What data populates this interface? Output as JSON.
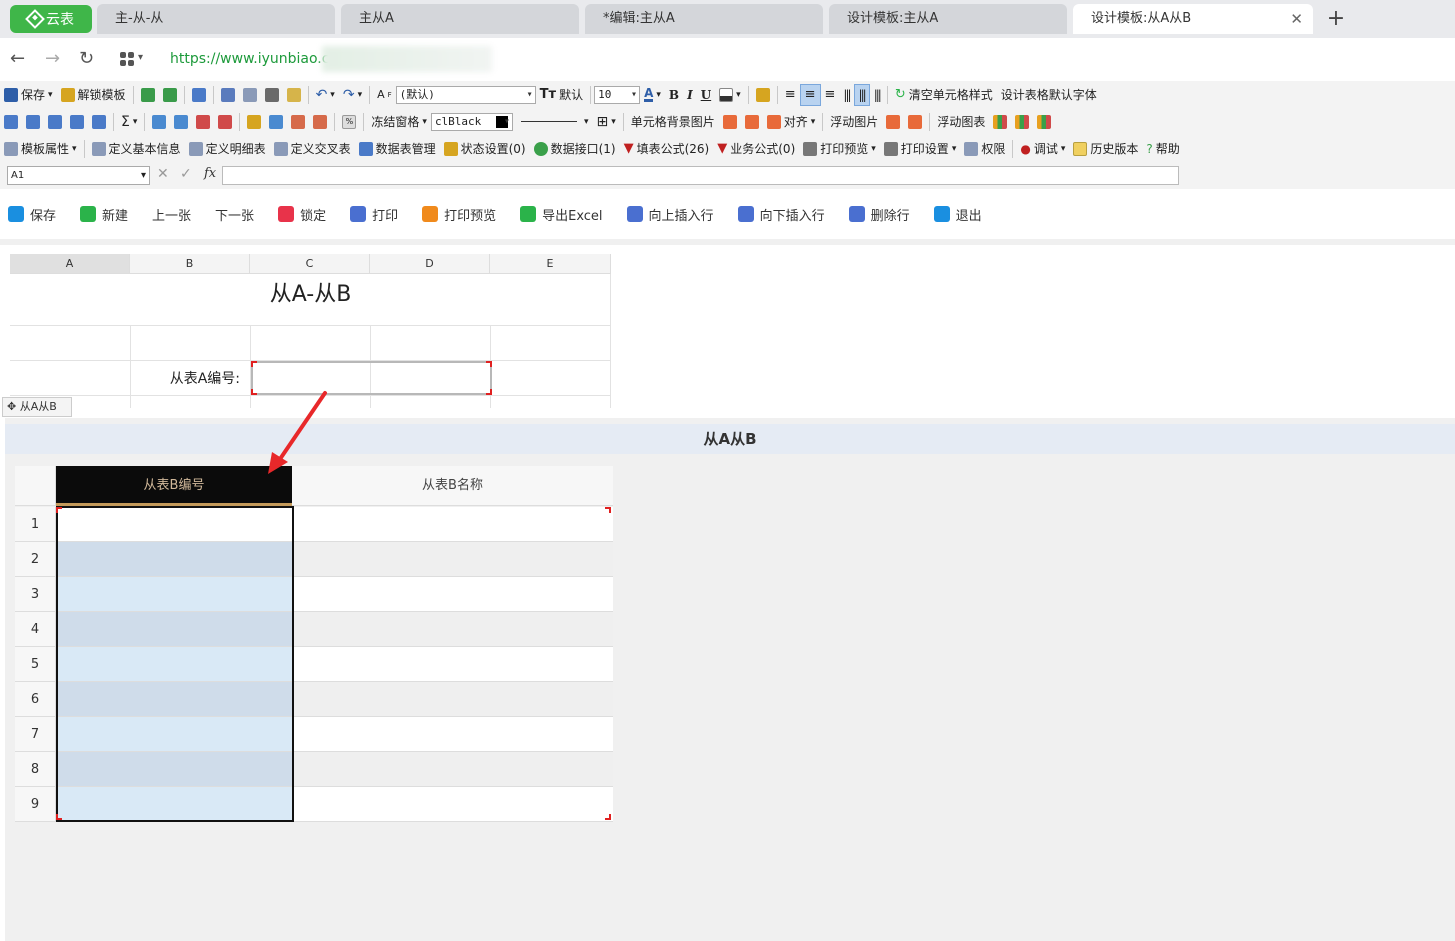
{
  "browser": {
    "brand": "云表",
    "tabs": [
      {
        "label": "主-从-从"
      },
      {
        "label": "主从A"
      },
      {
        "label": "*编辑:主从A"
      },
      {
        "label": "设计模板:主从A"
      },
      {
        "label": "设计模板:从A从B"
      }
    ],
    "url": "https://www.iyunbiao.cn/"
  },
  "toolbar1": {
    "save": "保存",
    "unlock_template": "解锁模板",
    "font_name": "(默认)",
    "default_label": "默认",
    "font_size": "10",
    "bold": "B",
    "italic": "I",
    "underline": "U",
    "clear_style": "清空单元格样式",
    "default_font": "设计表格默认字体"
  },
  "toolbar2": {
    "sigma": "Σ",
    "freeze": "冻结窗格",
    "color_name": "clBlack",
    "cell_bg_image": "单元格背景图片",
    "align": "对齐",
    "float_image": "浮动图片",
    "float_chart": "浮动图表"
  },
  "toolbar3": {
    "template_props": "模板属性",
    "define_basic": "定义基本信息",
    "define_detail": "定义明细表",
    "define_cross": "定义交叉表",
    "data_table_mgmt": "数据表管理",
    "status_settings": "状态设置(0)",
    "data_interface": "数据接口(1)",
    "fill_formula": "填表公式(26)",
    "business_formula": "业务公式(0)",
    "print_preview": "打印预览",
    "print_settings": "打印设置",
    "permissions": "权限",
    "debug": "调试",
    "history": "历史版本",
    "help": "帮助"
  },
  "formula_bar": {
    "cell_ref": "A1",
    "fx": "fx",
    "value": ""
  },
  "actions": [
    {
      "label": "保存",
      "color": "#1a8fe0"
    },
    {
      "label": "新建",
      "color": "#2bb34a"
    },
    {
      "label": "上一张",
      "color": ""
    },
    {
      "label": "下一张",
      "color": ""
    },
    {
      "label": "锁定",
      "color": "#e8334a"
    },
    {
      "label": "打印",
      "color": "#4a6fd0"
    },
    {
      "label": "打印预览",
      "color": "#f08a1c"
    },
    {
      "label": "导出Excel",
      "color": "#2bb34a"
    },
    {
      "label": "向上插入行",
      "color": "#4a6fd0"
    },
    {
      "label": "向下插入行",
      "color": "#4a6fd0"
    },
    {
      "label": "删除行",
      "color": "#4a6fd0"
    },
    {
      "label": "退出",
      "color": "#1a8fe0"
    }
  ],
  "sheet": {
    "columns": [
      "A",
      "B",
      "C",
      "D",
      "E"
    ],
    "title": "从A-从B",
    "field_label": "从表A编号:",
    "anchor_label": "从A从B"
  },
  "subform": {
    "title": "从A从B",
    "headers": [
      "从表B编号",
      "从表B名称"
    ],
    "row_numbers": [
      "1",
      "2",
      "3",
      "4",
      "5",
      "6",
      "7",
      "8",
      "9"
    ]
  }
}
